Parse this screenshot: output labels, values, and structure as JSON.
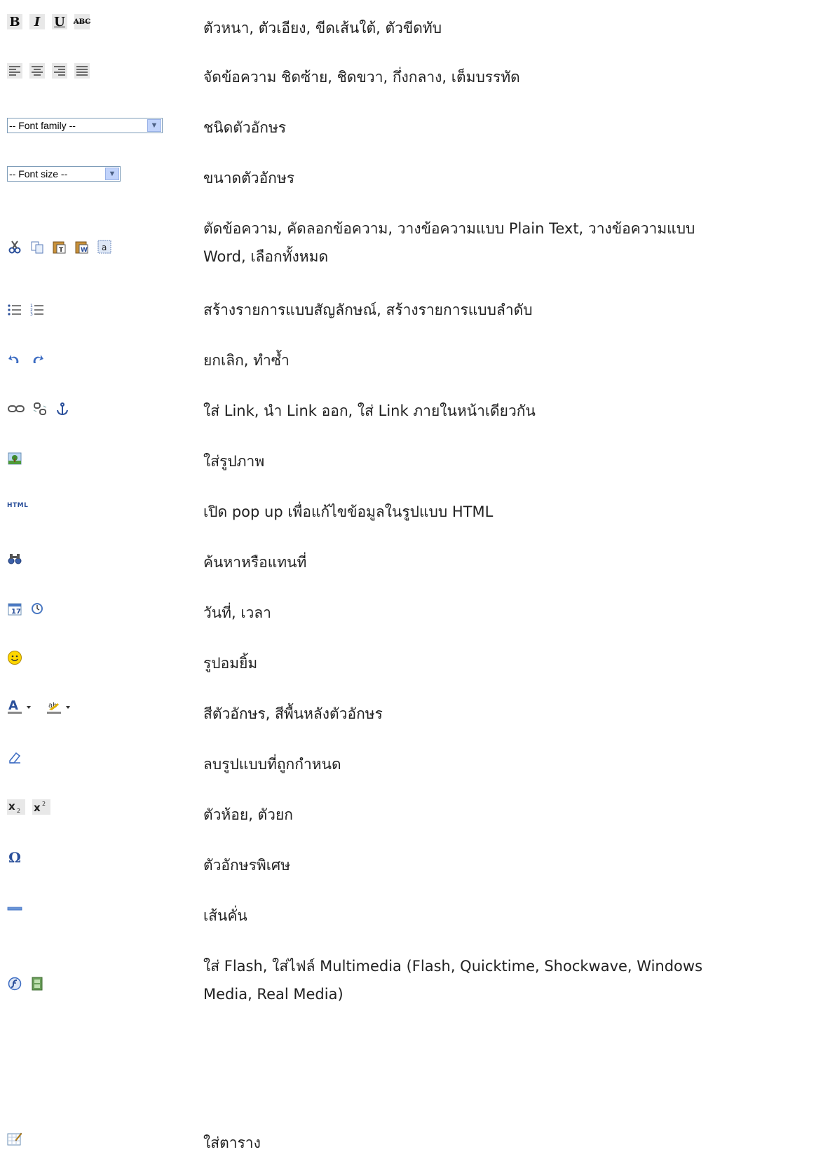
{
  "rows": [
    {
      "icons": [
        "bold-icon",
        "italic-icon",
        "underline-icon",
        "strikethrough-icon"
      ],
      "lines": [
        "ตัวหนา, ตัวเอียง, ขีดเส้นใต้, ตัวขีดทับ"
      ]
    },
    {
      "icons": [
        "align-left-icon",
        "align-center-icon",
        "align-right-icon",
        "align-justify-icon"
      ],
      "lines": [
        "จัดข้อความ ชิดซ้าย, ชิดขวา, กึ่งกลาง, เต็มบรรทัด"
      ]
    },
    {
      "icons": [
        "font-family-select"
      ],
      "select_label": "-- Font family --",
      "lines": [
        "ชนิดตัวอักษร"
      ]
    },
    {
      "icons": [
        "font-size-select"
      ],
      "select_label": "-- Font size --",
      "lines": [
        "ขนาดตัวอักษร"
      ]
    },
    {
      "icons": [
        "cut-icon",
        "copy-icon",
        "paste-text-icon",
        "paste-word-icon",
        "select-all-icon"
      ],
      "lines": [
        "ตัดข้อความ, คัดลอกข้อความ, วางข้อความแบบ Plain Text, วางข้อความแบบ",
        "Word, เลือกทั้งหมด"
      ]
    },
    {
      "icons": [
        "bullet-list-icon",
        "numbered-list-icon"
      ],
      "lines": [
        "สร้างรายการแบบสัญลักษณ์, สร้างรายการแบบลำดับ"
      ]
    },
    {
      "icons": [
        "undo-icon",
        "redo-icon"
      ],
      "lines": [
        "ยกเลิก, ทำซ้ำ"
      ]
    },
    {
      "icons": [
        "link-icon",
        "unlink-icon",
        "anchor-icon"
      ],
      "lines": [
        "ใส่ Link, นำ Link ออก, ใส่ Link ภายในหน้าเดียวกัน"
      ]
    },
    {
      "icons": [
        "image-icon"
      ],
      "lines": [
        "ใส่รูปภาพ"
      ]
    },
    {
      "icons": [
        "html-icon"
      ],
      "icon_text": "HTML",
      "lines": [
        "เปิด pop up เพื่อแก้ไขข้อมูลในรูปแบบ HTML"
      ]
    },
    {
      "icons": [
        "find-replace-icon"
      ],
      "lines": [
        "ค้นหาหรือแทนที่"
      ]
    },
    {
      "icons": [
        "date-icon",
        "time-icon"
      ],
      "lines": [
        "วันที่, เวลา"
      ]
    },
    {
      "icons": [
        "emoticon-icon"
      ],
      "lines": [
        "รูปอมยิ้ม"
      ]
    },
    {
      "icons": [
        "text-color-icon",
        "highlight-color-icon"
      ],
      "lines": [
        "สีตัวอักษร, สีพื้นหลังตัวอักษร"
      ]
    },
    {
      "icons": [
        "remove-format-icon"
      ],
      "lines": [
        "ลบรูปแบบที่ถูกกำหนด"
      ]
    },
    {
      "icons": [
        "subscript-icon",
        "superscript-icon"
      ],
      "lines": [
        "ตัวห้อย, ตัวยก"
      ]
    },
    {
      "icons": [
        "special-char-icon"
      ],
      "lines": [
        "ตัวอักษรพิเศษ"
      ]
    },
    {
      "icons": [
        "horizontal-rule-icon"
      ],
      "lines": [
        "เส้นคั่น"
      ]
    },
    {
      "icons": [
        "flash-icon",
        "media-icon"
      ],
      "lines": [
        "ใส่ Flash, ใส่ไฟล์ Multimedia (Flash, Quicktime, Shockwave, Windows",
        "Media, Real Media)"
      ]
    },
    {
      "icons": [
        "table-icon"
      ],
      "lines": [
        "ใส่ตาราง"
      ]
    }
  ]
}
